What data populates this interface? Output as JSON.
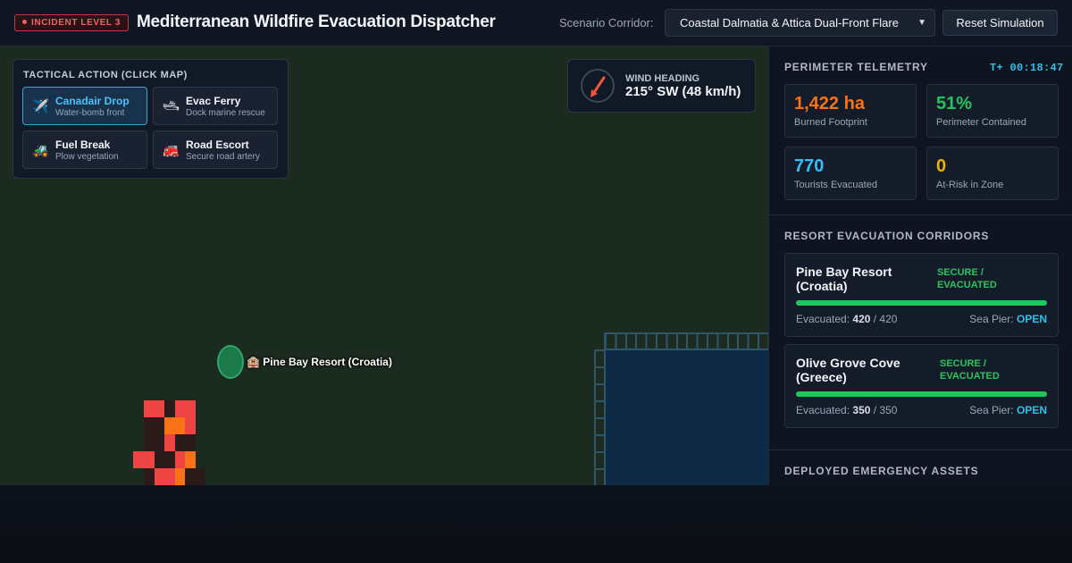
{
  "header": {
    "incident_badge": "INCIDENT LEVEL 3",
    "title": "Mediterranean Wildfire Evacuation Dispatcher",
    "scenario_label": "Scenario Corridor:",
    "scenario_value": "Coastal Dalmatia & Attica Dual-Front Flare",
    "reset_label": "Reset Simulation"
  },
  "tactical": {
    "title": "TACTICAL ACTION (CLICK MAP)",
    "actions": [
      {
        "name": "Canadair Drop",
        "desc": "Water-bomb front",
        "icon": "plane-icon",
        "active": true
      },
      {
        "name": "Evac Ferry",
        "desc": "Dock marine rescue",
        "icon": "ship-icon",
        "active": false
      },
      {
        "name": "Fuel Break",
        "desc": "Plow vegetation",
        "icon": "tractor-icon",
        "active": false
      },
      {
        "name": "Road Escort",
        "desc": "Secure road artery",
        "icon": "fire-engine-icon",
        "active": false
      }
    ]
  },
  "wind": {
    "label": "WIND HEADING",
    "value": "215° SW (48 km/h)",
    "arrow_color": "#f0543c"
  },
  "map": {
    "resort_label": "🏨 Pine Bay Resort (Croatia)"
  },
  "telemetry": {
    "title": "PERIMETER TELEMETRY",
    "timer": "T+ 00:18:47",
    "metrics": [
      {
        "value": "1,422 ha",
        "label": "Burned Footprint",
        "color": "#f97316"
      },
      {
        "value": "51%",
        "label": "Perimeter Contained",
        "color": "#22c55e"
      },
      {
        "value": "770",
        "label": "Tourists Evacuated",
        "color": "#38bdf8"
      },
      {
        "value": "0",
        "label": "At-Risk in Zone",
        "color": "#eab308"
      }
    ]
  },
  "corridors": {
    "title": "RESORT EVACUATION CORRIDORS",
    "resorts": [
      {
        "name": "Pine Bay Resort (Croatia)",
        "status": "SECURE / EVACUATED",
        "evacuated": "420",
        "total": "/ 420",
        "evac_label": "Evacuated:",
        "pier_label": "Sea Pier:",
        "pier_status": "OPEN",
        "progress": 1.0
      },
      {
        "name": "Olive Grove Cove (Greece)",
        "status": "SECURE / EVACUATED",
        "evacuated": "350",
        "total": "/ 350",
        "evac_label": "Evacuated:",
        "pier_label": "Sea Pier:",
        "pier_status": "OPEN",
        "progress": 1.0
      }
    ]
  },
  "assets": {
    "title": "DEPLOYED EMERGENCY ASSETS"
  },
  "colors": {
    "fire_hot": "#ef4444",
    "fire_orange": "#f97316",
    "fire_burned": "#2a1a1a"
  }
}
